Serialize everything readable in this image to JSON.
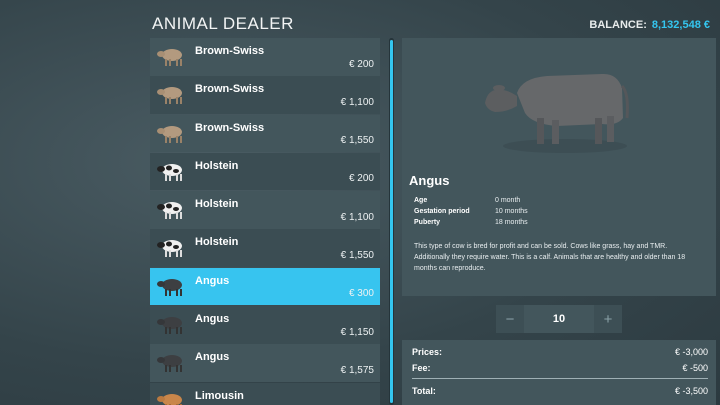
{
  "header": {
    "title": "ANIMAL DEALER",
    "balance_label": "BALANCE:",
    "balance_value": "8,132,548 €"
  },
  "list": {
    "items": [
      {
        "name": "Brown-Swiss",
        "price": "€ 200",
        "breed": "brown-swiss"
      },
      {
        "name": "Brown-Swiss",
        "price": "€ 1,100",
        "breed": "brown-swiss"
      },
      {
        "name": "Brown-Swiss",
        "price": "€ 1,550",
        "breed": "brown-swiss"
      },
      {
        "name": "Holstein",
        "price": "€ 200",
        "breed": "holstein"
      },
      {
        "name": "Holstein",
        "price": "€ 1,100",
        "breed": "holstein"
      },
      {
        "name": "Holstein",
        "price": "€ 1,550",
        "breed": "holstein"
      },
      {
        "name": "Angus",
        "price": "€ 300",
        "breed": "angus",
        "selected": true
      },
      {
        "name": "Angus",
        "price": "€ 1,150",
        "breed": "angus"
      },
      {
        "name": "Angus",
        "price": "€ 1,575",
        "breed": "angus"
      },
      {
        "name": "Limousin",
        "price": "",
        "breed": "limousin"
      }
    ]
  },
  "detail": {
    "name": "Angus",
    "stats": [
      {
        "label": "Age",
        "value": "0 month"
      },
      {
        "label": "Gestation period",
        "value": "10 months"
      },
      {
        "label": "Puberty",
        "value": "18 months"
      }
    ],
    "description": "This type of cow is bred for profit and can be sold. Cows like grass, hay and TMR. Additionally they require water. This is a calf. Animals that are healthy and older than 18 months can reproduce."
  },
  "quantity": {
    "minus": "−",
    "value": "10",
    "plus": "+"
  },
  "summary": {
    "prices_label": "Prices:",
    "prices_value": "€ -3,000",
    "fee_label": "Fee:",
    "fee_value": "€ -500",
    "total_label": "Total:",
    "total_value": "€ -3,500"
  },
  "colors": {
    "accent": "#37c4ef",
    "panel": "#43565c",
    "background": "#3a4a50"
  }
}
